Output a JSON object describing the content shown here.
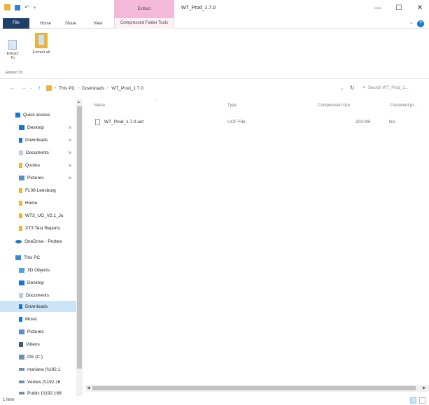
{
  "title_bar": {
    "context_tab": "Extract",
    "window_title": "WT_Prod_1.7.0",
    "minimize": "—",
    "maximize": "☐",
    "close": "✕"
  },
  "ribbon": {
    "tabs": [
      "File",
      "Home",
      "Share",
      "View",
      "Compressed Folder Tools"
    ],
    "extract_to_label": "Extract To",
    "extract_all_label": "Extract all",
    "group_label": "Extract To"
  },
  "address": {
    "back": "←",
    "forward": "→",
    "up": "↑",
    "crumbs": [
      "This PC",
      "Downloads",
      "WT_Prod_1.7.0"
    ],
    "separator": "›",
    "search_placeholder": "Search WT_Prod_1..."
  },
  "nav_pane": {
    "items": [
      {
        "label": "Quick access",
        "icon": "star-icon",
        "pinned": false
      },
      {
        "label": "Desktop",
        "icon": "desktop-icon",
        "pinned": true
      },
      {
        "label": "Downloads",
        "icon": "downloads-icon",
        "pinned": true
      },
      {
        "label": "Documents",
        "icon": "documents-icon",
        "pinned": true
      },
      {
        "label": "Quotes",
        "icon": "folder-icon",
        "pinned": true
      },
      {
        "label": "Pictures",
        "icon": "pictures-icon",
        "pinned": true
      },
      {
        "label": "FL08 Leesburg",
        "icon": "folder-icon",
        "pinned": false
      },
      {
        "label": "Home",
        "icon": "folder-icon",
        "pinned": false
      },
      {
        "label": "WT3_UG_V2.1_Ju",
        "icon": "folder-icon",
        "pinned": false
      },
      {
        "label": "XT3 Test Reports",
        "icon": "folder-icon",
        "pinned": false
      },
      {
        "label": "OneDrive - Probes",
        "icon": "onedrive-icon",
        "pinned": false
      },
      {
        "label": "This PC",
        "icon": "this-pc-icon",
        "pinned": false
      },
      {
        "label": "3D Objects",
        "icon": "3d-objects-icon",
        "pinned": false
      },
      {
        "label": "Desktop",
        "icon": "desktop-icon",
        "pinned": false
      },
      {
        "label": "Documents",
        "icon": "documents-icon",
        "pinned": false
      },
      {
        "label": "Downloads",
        "icon": "downloads-icon",
        "pinned": false
      },
      {
        "label": "Music",
        "icon": "music-icon",
        "pinned": false
      },
      {
        "label": "Pictures",
        "icon": "pictures-icon",
        "pinned": false
      },
      {
        "label": "Videos",
        "icon": "videos-icon",
        "pinned": false
      },
      {
        "label": "OS (C:)",
        "icon": "drive-icon",
        "pinned": false
      },
      {
        "label": "mariana (\\\\192.1",
        "icon": "network-drive-icon",
        "pinned": false
      },
      {
        "label": "Ventes (\\\\192.16",
        "icon": "network-drive-icon",
        "pinned": false
      },
      {
        "label": "Public (\\\\192.168",
        "icon": "network-drive-icon",
        "pinned": false
      }
    ],
    "selected_index": 15,
    "pin_glyph": "⇲"
  },
  "file_list": {
    "columns": [
      "Name",
      "Type",
      "Compressed size",
      "Password pr..."
    ],
    "files": [
      {
        "name": "WT_Prod_1.7.0.ucf",
        "type": "UCF File",
        "size": "203 KB",
        "password": "No"
      }
    ]
  },
  "status_bar": {
    "text": "1 item"
  },
  "colors": {
    "file_tab": "#1f3f6b",
    "context_tab": "#f4b8d9",
    "selection": "#cce4f7",
    "accent": "#1976d2"
  }
}
